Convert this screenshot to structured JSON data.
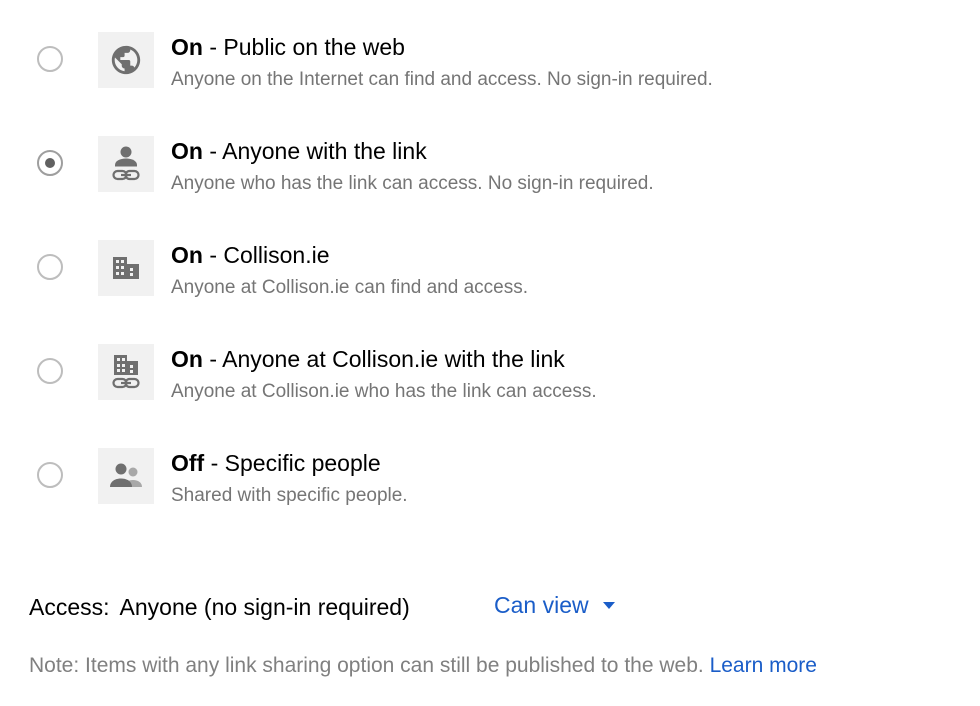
{
  "options": [
    {
      "state": "On",
      "separator": " - ",
      "label": "Public on the web",
      "description": "Anyone on the Internet can find and access. No sign-in required.",
      "icon": "globe-icon",
      "selected": false
    },
    {
      "state": "On",
      "separator": " - ",
      "label": "Anyone with the link",
      "description": "Anyone who has the link can access. No sign-in required.",
      "icon": "person-link-icon",
      "selected": true
    },
    {
      "state": "On",
      "separator": " - ",
      "label": "Collison.ie",
      "description": "Anyone at Collison.ie can find and access.",
      "icon": "building-icon",
      "selected": false
    },
    {
      "state": "On",
      "separator": " - ",
      "label": "Anyone at Collison.ie with the link",
      "description": "Anyone at Collison.ie who has the link can access.",
      "icon": "building-link-icon",
      "selected": false
    },
    {
      "state": "Off",
      "separator": " - ",
      "label": "Specific people",
      "description": "Shared with specific people.",
      "icon": "people-icon",
      "selected": false
    }
  ],
  "access": {
    "label": "Access:",
    "value": "Anyone (no sign-in required)",
    "permission": "Can view"
  },
  "note": {
    "text": "Note: Items with any link sharing option can still be published to the web.",
    "link": "Learn more"
  },
  "colors": {
    "link": "#1a5dc8",
    "muted_text": "#757575",
    "icon": "#757575",
    "icon_background": "#f1f1f1"
  }
}
